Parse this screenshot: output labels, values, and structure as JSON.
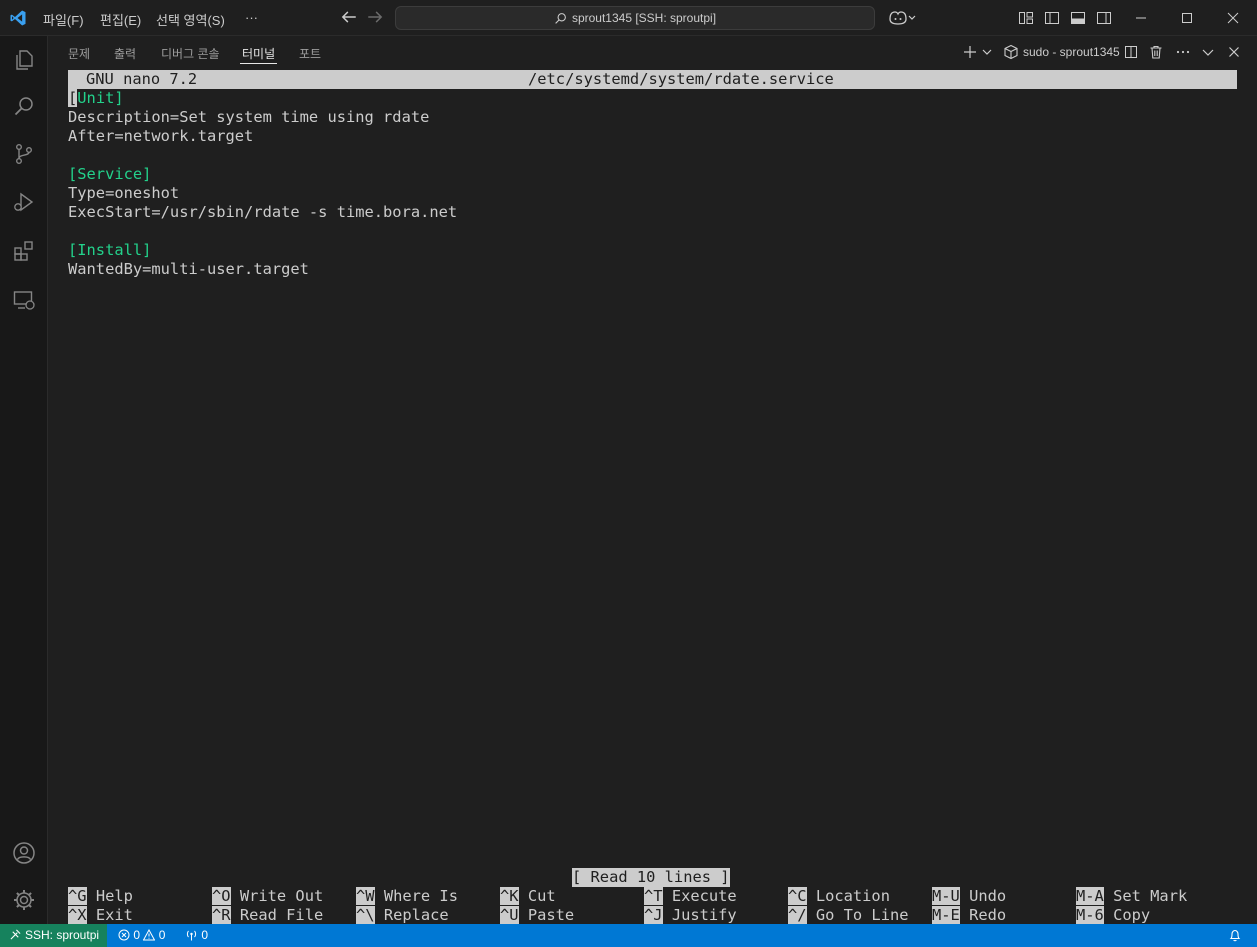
{
  "titlebar": {
    "menus": [
      "파일(F)",
      "편집(E)",
      "선택 영역(S)",
      "···"
    ],
    "search_text": "sprout1345 [SSH: sproutpi]"
  },
  "panel": {
    "tabs": [
      "문제",
      "출력",
      "디버그 콘솔",
      "터미널",
      "포트"
    ],
    "active_tab": "터미널",
    "terminal_name": "sudo - sprout1345"
  },
  "nano": {
    "header_left": "GNU nano 7.2",
    "header_file": "/etc/systemd/system/rdate.service",
    "lines": [
      {
        "prefix": "",
        "section": "[Unit]",
        "text": ""
      },
      {
        "prefix": "",
        "section": "",
        "text": "Description=Set system time using rdate"
      },
      {
        "prefix": "",
        "section": "",
        "text": "After=network.target"
      },
      {
        "prefix": "",
        "section": "",
        "text": ""
      },
      {
        "prefix": "",
        "section": "[Service]",
        "text": ""
      },
      {
        "prefix": "",
        "section": "",
        "text": "Type=oneshot"
      },
      {
        "prefix": "",
        "section": "",
        "text": "ExecStart=/usr/sbin/rdate -s time.bora.net"
      },
      {
        "prefix": "",
        "section": "",
        "text": ""
      },
      {
        "prefix": "",
        "section": "[Install]",
        "text": ""
      },
      {
        "prefix": "",
        "section": "",
        "text": "WantedBy=multi-user.target"
      }
    ],
    "status_message": "[ Read 10 lines ]",
    "shortcuts_row1": [
      {
        "key": "^G",
        "label": "Help"
      },
      {
        "key": "^O",
        "label": "Write Out"
      },
      {
        "key": "^W",
        "label": "Where Is"
      },
      {
        "key": "^K",
        "label": "Cut"
      },
      {
        "key": "^T",
        "label": "Execute"
      },
      {
        "key": "^C",
        "label": "Location"
      },
      {
        "key": "M-U",
        "label": "Undo"
      },
      {
        "key": "M-A",
        "label": "Set Mark"
      }
    ],
    "shortcuts_row2": [
      {
        "key": "^X",
        "label": "Exit"
      },
      {
        "key": "^R",
        "label": "Read File"
      },
      {
        "key": "^\\",
        "label": "Replace"
      },
      {
        "key": "^U",
        "label": "Paste"
      },
      {
        "key": "^J",
        "label": "Justify"
      },
      {
        "key": "^/",
        "label": "Go To Line"
      },
      {
        "key": "M-E",
        "label": "Redo"
      },
      {
        "key": "M-6",
        "label": "Copy"
      }
    ]
  },
  "statusbar": {
    "remote": "SSH: sproutpi",
    "errors": "0",
    "warnings": "0",
    "ports": "0"
  },
  "colors": {
    "accent": "#0078d4",
    "remote": "#16825d",
    "section": "#23d18b"
  }
}
